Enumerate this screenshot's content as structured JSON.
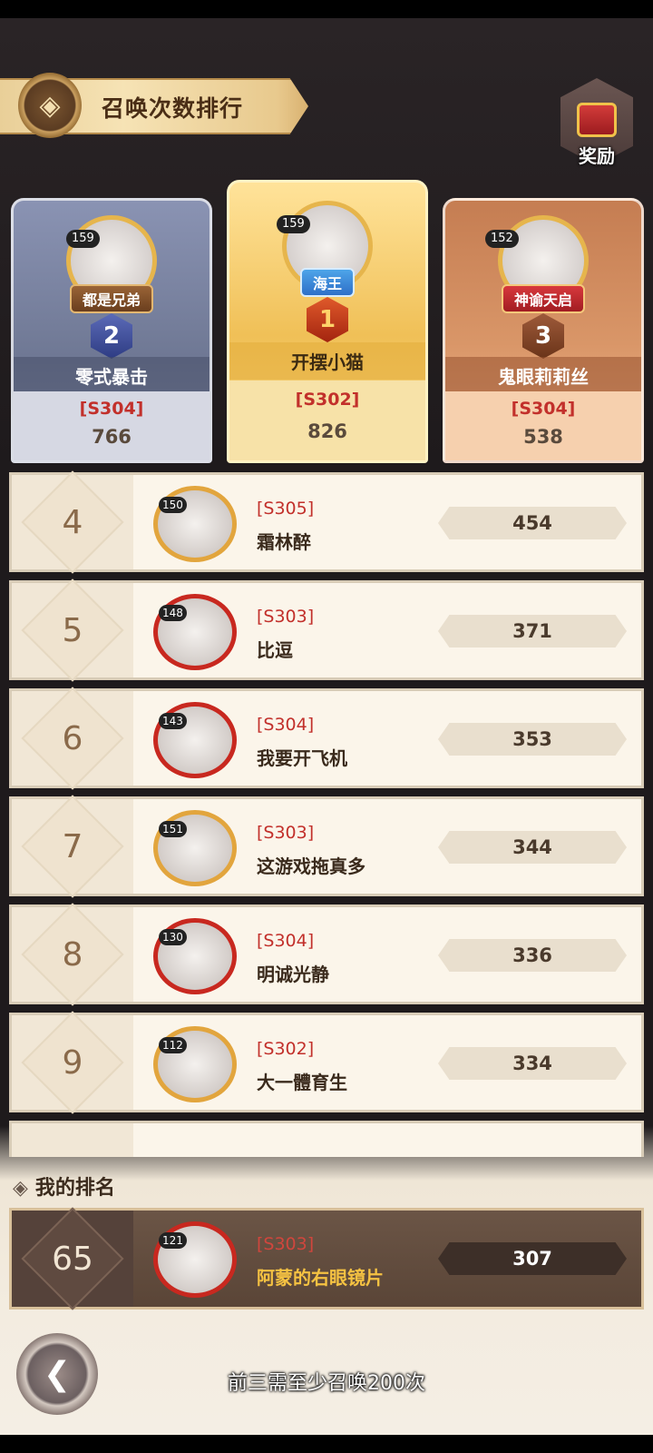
{
  "header": {
    "title": "召唤次数排行",
    "reward_label": "奖励"
  },
  "podium": [
    {
      "rank": "2",
      "level": "159",
      "title": "都是兄弟",
      "name": "零式暴击",
      "server": "[S304]",
      "score": "766"
    },
    {
      "rank": "1",
      "level": "159",
      "title": "海王",
      "name": "开摆小猫",
      "server": "[S302]",
      "score": "826"
    },
    {
      "rank": "3",
      "level": "152",
      "title": "神谕天启",
      "name": "鬼眼莉莉丝",
      "server": "[S304]",
      "score": "538"
    }
  ],
  "rows": [
    {
      "rank": "4",
      "level": "150",
      "server": "[S305]",
      "name": "霜林醉",
      "score": "454"
    },
    {
      "rank": "5",
      "level": "148",
      "server": "[S303]",
      "name": "比逗",
      "score": "371"
    },
    {
      "rank": "6",
      "level": "143",
      "server": "[S304]",
      "name": "我要开飞机",
      "score": "353"
    },
    {
      "rank": "7",
      "level": "151",
      "server": "[S303]",
      "name": "这游戏拖真多",
      "score": "344"
    },
    {
      "rank": "8",
      "level": "130",
      "server": "[S304]",
      "name": "明诚光静",
      "score": "336"
    },
    {
      "rank": "9",
      "level": "112",
      "server": "[S302]",
      "name": "大一體育生",
      "score": "334"
    }
  ],
  "my_rank": {
    "label": "我的排名",
    "rank": "65",
    "level": "121",
    "server": "[S303]",
    "name": "阿蒙的右眼镜片",
    "score": "307"
  },
  "footer_note": "前三需至少召唤200次",
  "icons": {
    "title_emblem": "shield-emblem-icon",
    "reward": "treasure-chest-icon",
    "back": "back-arrow-icon"
  }
}
